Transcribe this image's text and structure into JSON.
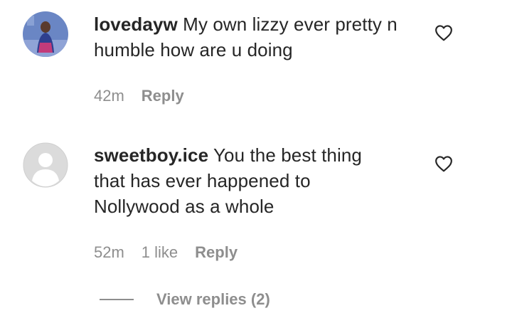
{
  "comments": [
    {
      "username": "lovedayw",
      "text": " My own lizzy ever pretty n humble how are u doing",
      "time": "42m",
      "reply_label": "Reply",
      "avatar": "user-photo-avatar",
      "like_icon": "heart-outline-icon"
    },
    {
      "username": "sweetboy.ice",
      "text": " You the best thing that has ever happened to Nollywood as a whole",
      "time": "52m",
      "likes": "1 like",
      "reply_label": "Reply",
      "avatar": "default-avatar",
      "like_icon": "heart-outline-icon"
    }
  ],
  "view_replies": {
    "label": "View replies (2)"
  },
  "colors": {
    "text": "#262626",
    "secondary": "#8e8e8e",
    "background": "#ffffff"
  }
}
